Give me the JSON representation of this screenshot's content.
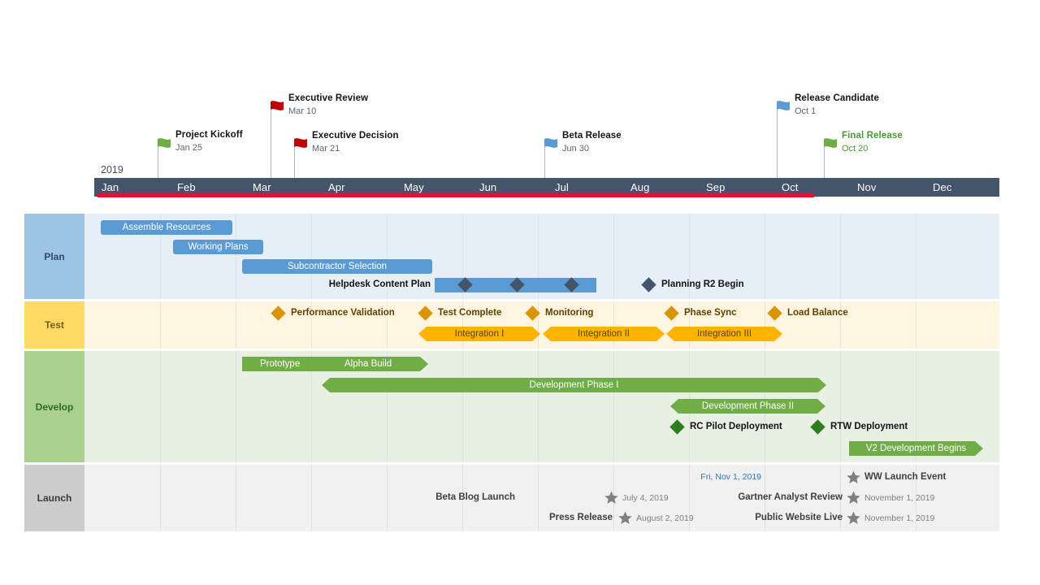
{
  "timeline": {
    "year_label": "2019",
    "months": [
      "Jan",
      "Feb",
      "Mar",
      "Apr",
      "May",
      "Jun",
      "Jul",
      "Aug",
      "Sep",
      "Oct",
      "Nov",
      "Dec"
    ],
    "axis_color": "#44546a",
    "progress_color": "#e8112d",
    "progress_through_month": "Oct"
  },
  "flags": [
    {
      "title": "Project Kickoff",
      "date": "Jan 25",
      "color": "#70ad47",
      "icon": "flag-icon-green"
    },
    {
      "title": "Executive Review",
      "date": "Mar 10",
      "color": "#c00000",
      "icon": "flag-icon-red"
    },
    {
      "title": "Executive Decision",
      "date": "Mar 21",
      "color": "#c00000",
      "icon": "flag-icon-red"
    },
    {
      "title": "Beta Release",
      "date": "Jun 30",
      "color": "#5b9bd5",
      "icon": "flag-icon-blue"
    },
    {
      "title": "Release Candidate",
      "date": "Oct 1",
      "color": "#5b9bd5",
      "icon": "flag-icon-blue"
    },
    {
      "title": "Final Release",
      "date": "Oct 20",
      "color": "#70ad47",
      "icon": "flag-icon-green"
    }
  ],
  "lanes": [
    {
      "name": "Plan",
      "label_color": "#9dc3e6",
      "body_color": "#e6eef7",
      "bars": [
        {
          "label": "Assemble Resources",
          "style": "rounded"
        },
        {
          "label": "Working Plans",
          "style": "rounded"
        },
        {
          "label": "Subcontractor Selection",
          "style": "rounded"
        },
        {
          "label": "Helpdesk Content Plan",
          "style": "left-label"
        }
      ],
      "milestones": [
        {
          "label": "Planning R2 Begin",
          "marker": "diamond-slate"
        }
      ]
    },
    {
      "name": "Test",
      "label_color": "#ffd966",
      "body_color": "#fdf5e0",
      "milestones": [
        {
          "label": "Performance Validation",
          "marker": "diamond-amber"
        },
        {
          "label": "Test Complete",
          "marker": "diamond-amber"
        },
        {
          "label": "Monitoring",
          "marker": "diamond-amber"
        },
        {
          "label": "Phase Sync",
          "marker": "diamond-amber"
        },
        {
          "label": "Load Balance",
          "marker": "diamond-amber"
        }
      ],
      "bars": [
        {
          "label": "Integration I",
          "style": "arrow-lr"
        },
        {
          "label": "Integration II",
          "style": "arrow-lr"
        },
        {
          "label": "Integration III",
          "style": "arrow-lr"
        }
      ]
    },
    {
      "name": "Develop",
      "label_color": "#a9d08e",
      "body_color": "#e7f0e2",
      "bars": [
        {
          "label": "Prototype",
          "style": "plain"
        },
        {
          "label": "Alpha Build",
          "style": "arrow-r"
        },
        {
          "label": "Development Phase I",
          "style": "arrow-lr"
        },
        {
          "label": "Development Phase II",
          "style": "arrow-lr"
        },
        {
          "label": "V2 Development Begins",
          "style": "arrow-r"
        }
      ],
      "milestones": [
        {
          "label": "RC Pilot Deployment",
          "marker": "diamond-green"
        },
        {
          "label": "RTW Deployment",
          "marker": "diamond-green"
        }
      ]
    },
    {
      "name": "Launch",
      "label_color": "#cccccc",
      "body_color": "#f0f0f0",
      "events": [
        {
          "name": "WW Launch Event",
          "date": "Fri, Nov 1, 2019",
          "date_position": "left",
          "marker": "star-icon"
        },
        {
          "name": "Beta Blog Launch",
          "date": "July 4, 2019",
          "date_position": "right",
          "marker": "star-icon"
        },
        {
          "name": "Gartner Analyst Review",
          "date": "November 1, 2019",
          "date_position": "right",
          "marker": "star-icon"
        },
        {
          "name": "Press Release",
          "date": "August 2, 2019",
          "date_position": "right",
          "marker": "star-icon"
        },
        {
          "name": "Public Website Live",
          "date": "November 1, 2019",
          "date_position": "right",
          "marker": "star-icon"
        }
      ]
    }
  ]
}
